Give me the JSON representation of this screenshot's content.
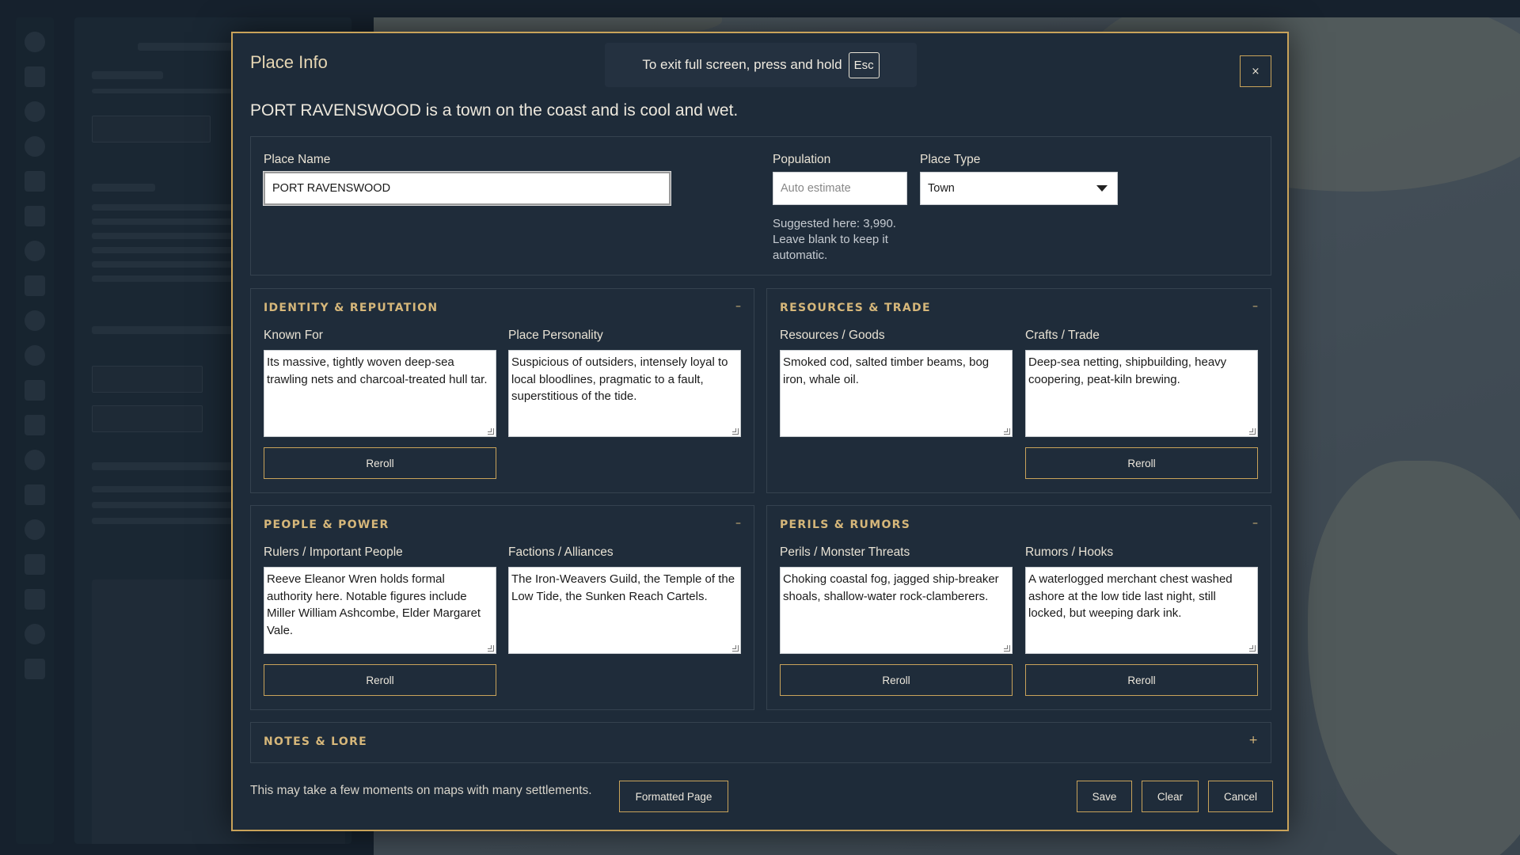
{
  "dialog": {
    "title": "Place Info",
    "close_label": "×",
    "summary": "PORT RAVENSWOOD is a town on the coast and is cool and wet."
  },
  "fullscreen_notice": {
    "text": "To exit full screen, press and hold",
    "key": "Esc"
  },
  "basics": {
    "place_name_label": "Place Name",
    "place_name_value": "PORT RAVENSWOOD",
    "population_label": "Population",
    "population_placeholder": "Auto estimate",
    "population_hint": "Suggested here: 3,990. Leave blank to keep it automatic.",
    "place_type_label": "Place Type",
    "place_type_value": "Town"
  },
  "sections": {
    "identity": {
      "title": "IDENTITY & REPUTATION",
      "toggle": "–",
      "known_for_label": "Known For",
      "known_for_value": "Its massive, tightly woven deep-sea trawling nets and charcoal-treated hull tar.",
      "personality_label": "Place Personality",
      "personality_value": "Suspicious of outsiders, intensely loyal to local bloodlines, pragmatic to a fault, superstitious of the tide.",
      "reroll_label": "Reroll"
    },
    "resources": {
      "title": "RESOURCES & TRADE",
      "toggle": "–",
      "goods_label": "Resources / Goods",
      "goods_value": "Smoked cod, salted timber beams, bog iron, whale oil.",
      "crafts_label": "Crafts / Trade",
      "crafts_value": "Deep-sea netting, shipbuilding, heavy coopering, peat-kiln brewing.",
      "reroll_label": "Reroll"
    },
    "people": {
      "title": "PEOPLE & POWER",
      "toggle": "–",
      "rulers_label": "Rulers / Important People",
      "rulers_value": "Reeve Eleanor Wren holds formal authority here. Notable figures include Miller William Ashcombe, Elder Margaret Vale.",
      "factions_label": "Factions / Alliances",
      "factions_value": "The Iron-Weavers Guild, the Temple of the Low Tide, the Sunken Reach Cartels.",
      "reroll_label": "Reroll"
    },
    "perils": {
      "title": "PERILS & RUMORS",
      "toggle": "–",
      "threats_label": "Perils / Monster Threats",
      "threats_value": "Choking coastal fog, jagged ship-breaker shoals, shallow-water rock-clamberers.",
      "rumors_label": "Rumors / Hooks",
      "rumors_value": "A waterlogged merchant chest washed ashore at the low tide last night, still locked, but weeping dark ink.",
      "reroll_threats_label": "Reroll",
      "reroll_rumors_label": "Reroll"
    },
    "notes": {
      "title": "NOTES & LORE",
      "toggle": "+"
    }
  },
  "footer": {
    "note": "This may take a few moments on maps with many settlements.",
    "formatted_page_label": "Formatted Page",
    "save_label": "Save",
    "clear_label": "Clear",
    "cancel_label": "Cancel"
  },
  "colors": {
    "accent": "#c9a35a",
    "section_heading": "#d6b77a",
    "modal_bg": "#1e2b39"
  }
}
